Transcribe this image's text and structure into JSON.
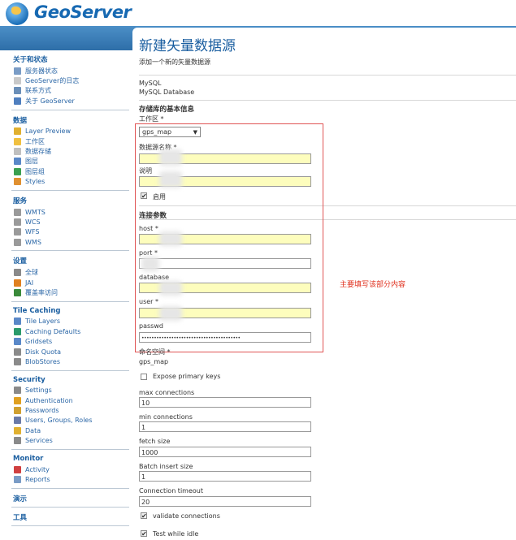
{
  "app": {
    "name": "GeoServer"
  },
  "sidebar": {
    "sections": [
      {
        "title": "关于和状态",
        "items": [
          {
            "label": "服务器状态",
            "icon": "server-status-icon",
            "color": "#7a9cc6"
          },
          {
            "label": "GeoServer的日志",
            "icon": "log-icon",
            "color": "#c9c9c9"
          },
          {
            "label": "联系方式",
            "icon": "contact-icon",
            "color": "#6b8fb8"
          },
          {
            "label": "关于 GeoServer",
            "icon": "info-icon",
            "color": "#4f7fbf"
          }
        ]
      },
      {
        "title": "数据",
        "items": [
          {
            "label": "Layer Preview",
            "icon": "layer-preview-icon",
            "color": "#e0b030"
          },
          {
            "label": "工作区",
            "icon": "folder-icon",
            "color": "#f0c040"
          },
          {
            "label": "数据存储",
            "icon": "datastore-icon",
            "color": "#c0c0c0"
          },
          {
            "label": "图层",
            "icon": "layers-icon",
            "color": "#5a88c8"
          },
          {
            "label": "图层组",
            "icon": "layer-group-icon",
            "color": "#3aa050"
          },
          {
            "label": "Styles",
            "icon": "styles-icon",
            "color": "#e09030"
          }
        ]
      },
      {
        "title": "服务",
        "items": [
          {
            "label": "WMTS",
            "icon": "wmts-icon",
            "color": "#9a9a9a"
          },
          {
            "label": "WCS",
            "icon": "wcs-icon",
            "color": "#9a9a9a"
          },
          {
            "label": "WFS",
            "icon": "wfs-icon",
            "color": "#9a9a9a"
          },
          {
            "label": "WMS",
            "icon": "wms-icon",
            "color": "#9a9a9a"
          }
        ]
      },
      {
        "title": "设置",
        "items": [
          {
            "label": "全球",
            "icon": "global-settings-icon",
            "color": "#8a8a8a"
          },
          {
            "label": "JAI",
            "icon": "jai-icon",
            "color": "#e08020"
          },
          {
            "label": "覆盖率访问",
            "icon": "coverage-access-icon",
            "color": "#3a8a3a"
          }
        ]
      },
      {
        "title": "Tile Caching",
        "items": [
          {
            "label": "Tile Layers",
            "icon": "tile-layers-icon",
            "color": "#5a88c8"
          },
          {
            "label": "Caching Defaults",
            "icon": "globe-icon",
            "color": "#2a9a6a"
          },
          {
            "label": "Gridsets",
            "icon": "gridsets-icon",
            "color": "#5a88c8"
          },
          {
            "label": "Disk Quota",
            "icon": "disk-icon",
            "color": "#8a8a8a"
          },
          {
            "label": "BlobStores",
            "icon": "blobstores-icon",
            "color": "#8a8a8a"
          }
        ]
      },
      {
        "title": "Security",
        "items": [
          {
            "label": "Settings",
            "icon": "wrench-icon",
            "color": "#8a8a8a"
          },
          {
            "label": "Authentication",
            "icon": "shield-icon",
            "color": "#e0a020"
          },
          {
            "label": "Passwords",
            "icon": "key-icon",
            "color": "#d0a030"
          },
          {
            "label": "Users, Groups, Roles",
            "icon": "users-icon",
            "color": "#6a7aa8"
          },
          {
            "label": "Data",
            "icon": "data-security-icon",
            "color": "#e0b030"
          },
          {
            "label": "Services",
            "icon": "services-security-icon",
            "color": "#8a8a8a"
          }
        ]
      },
      {
        "title": "Monitor",
        "items": [
          {
            "label": "Activity",
            "icon": "activity-icon",
            "color": "#d04040"
          },
          {
            "label": "Reports",
            "icon": "reports-icon",
            "color": "#7a9cc6"
          }
        ]
      },
      {
        "title": "演示",
        "items": []
      },
      {
        "title": "工具",
        "items": []
      }
    ]
  },
  "main": {
    "title": "新建矢量数据源",
    "description": "添加一个新的矢量数据源",
    "store_type": "MySQL",
    "store_type_desc": "MySQL Database",
    "basic_header": "存储库的基本信息",
    "workspace_label": "工作区 *",
    "workspace_value": "gps_map",
    "datasource_label": "数据源名称 *",
    "description_label": "说明",
    "enabled_label": "启用",
    "connection_header": "连接参数",
    "host_label": "host *",
    "port_label": "port *",
    "database_label": "database",
    "user_label": "user *",
    "passwd_label": "passwd",
    "passwd_value": "••••••••••••••••••••••••••••••••••••••••",
    "namespace_label": "命名空间 *",
    "namespace_value": "gps_map",
    "expose_label": "Expose primary keys",
    "max_conn_label": "max connections",
    "max_conn_value": "10",
    "min_conn_label": "min connections",
    "min_conn_value": "1",
    "fetch_label": "fetch size",
    "fetch_value": "1000",
    "batch_label": "Batch insert size",
    "batch_value": "1",
    "timeout_label": "Connection timeout",
    "timeout_value": "20",
    "validate_label": "validate connections",
    "test_idle_label": "Test while idle",
    "annotation": "主要填写该部分内容",
    "check": "✔"
  }
}
